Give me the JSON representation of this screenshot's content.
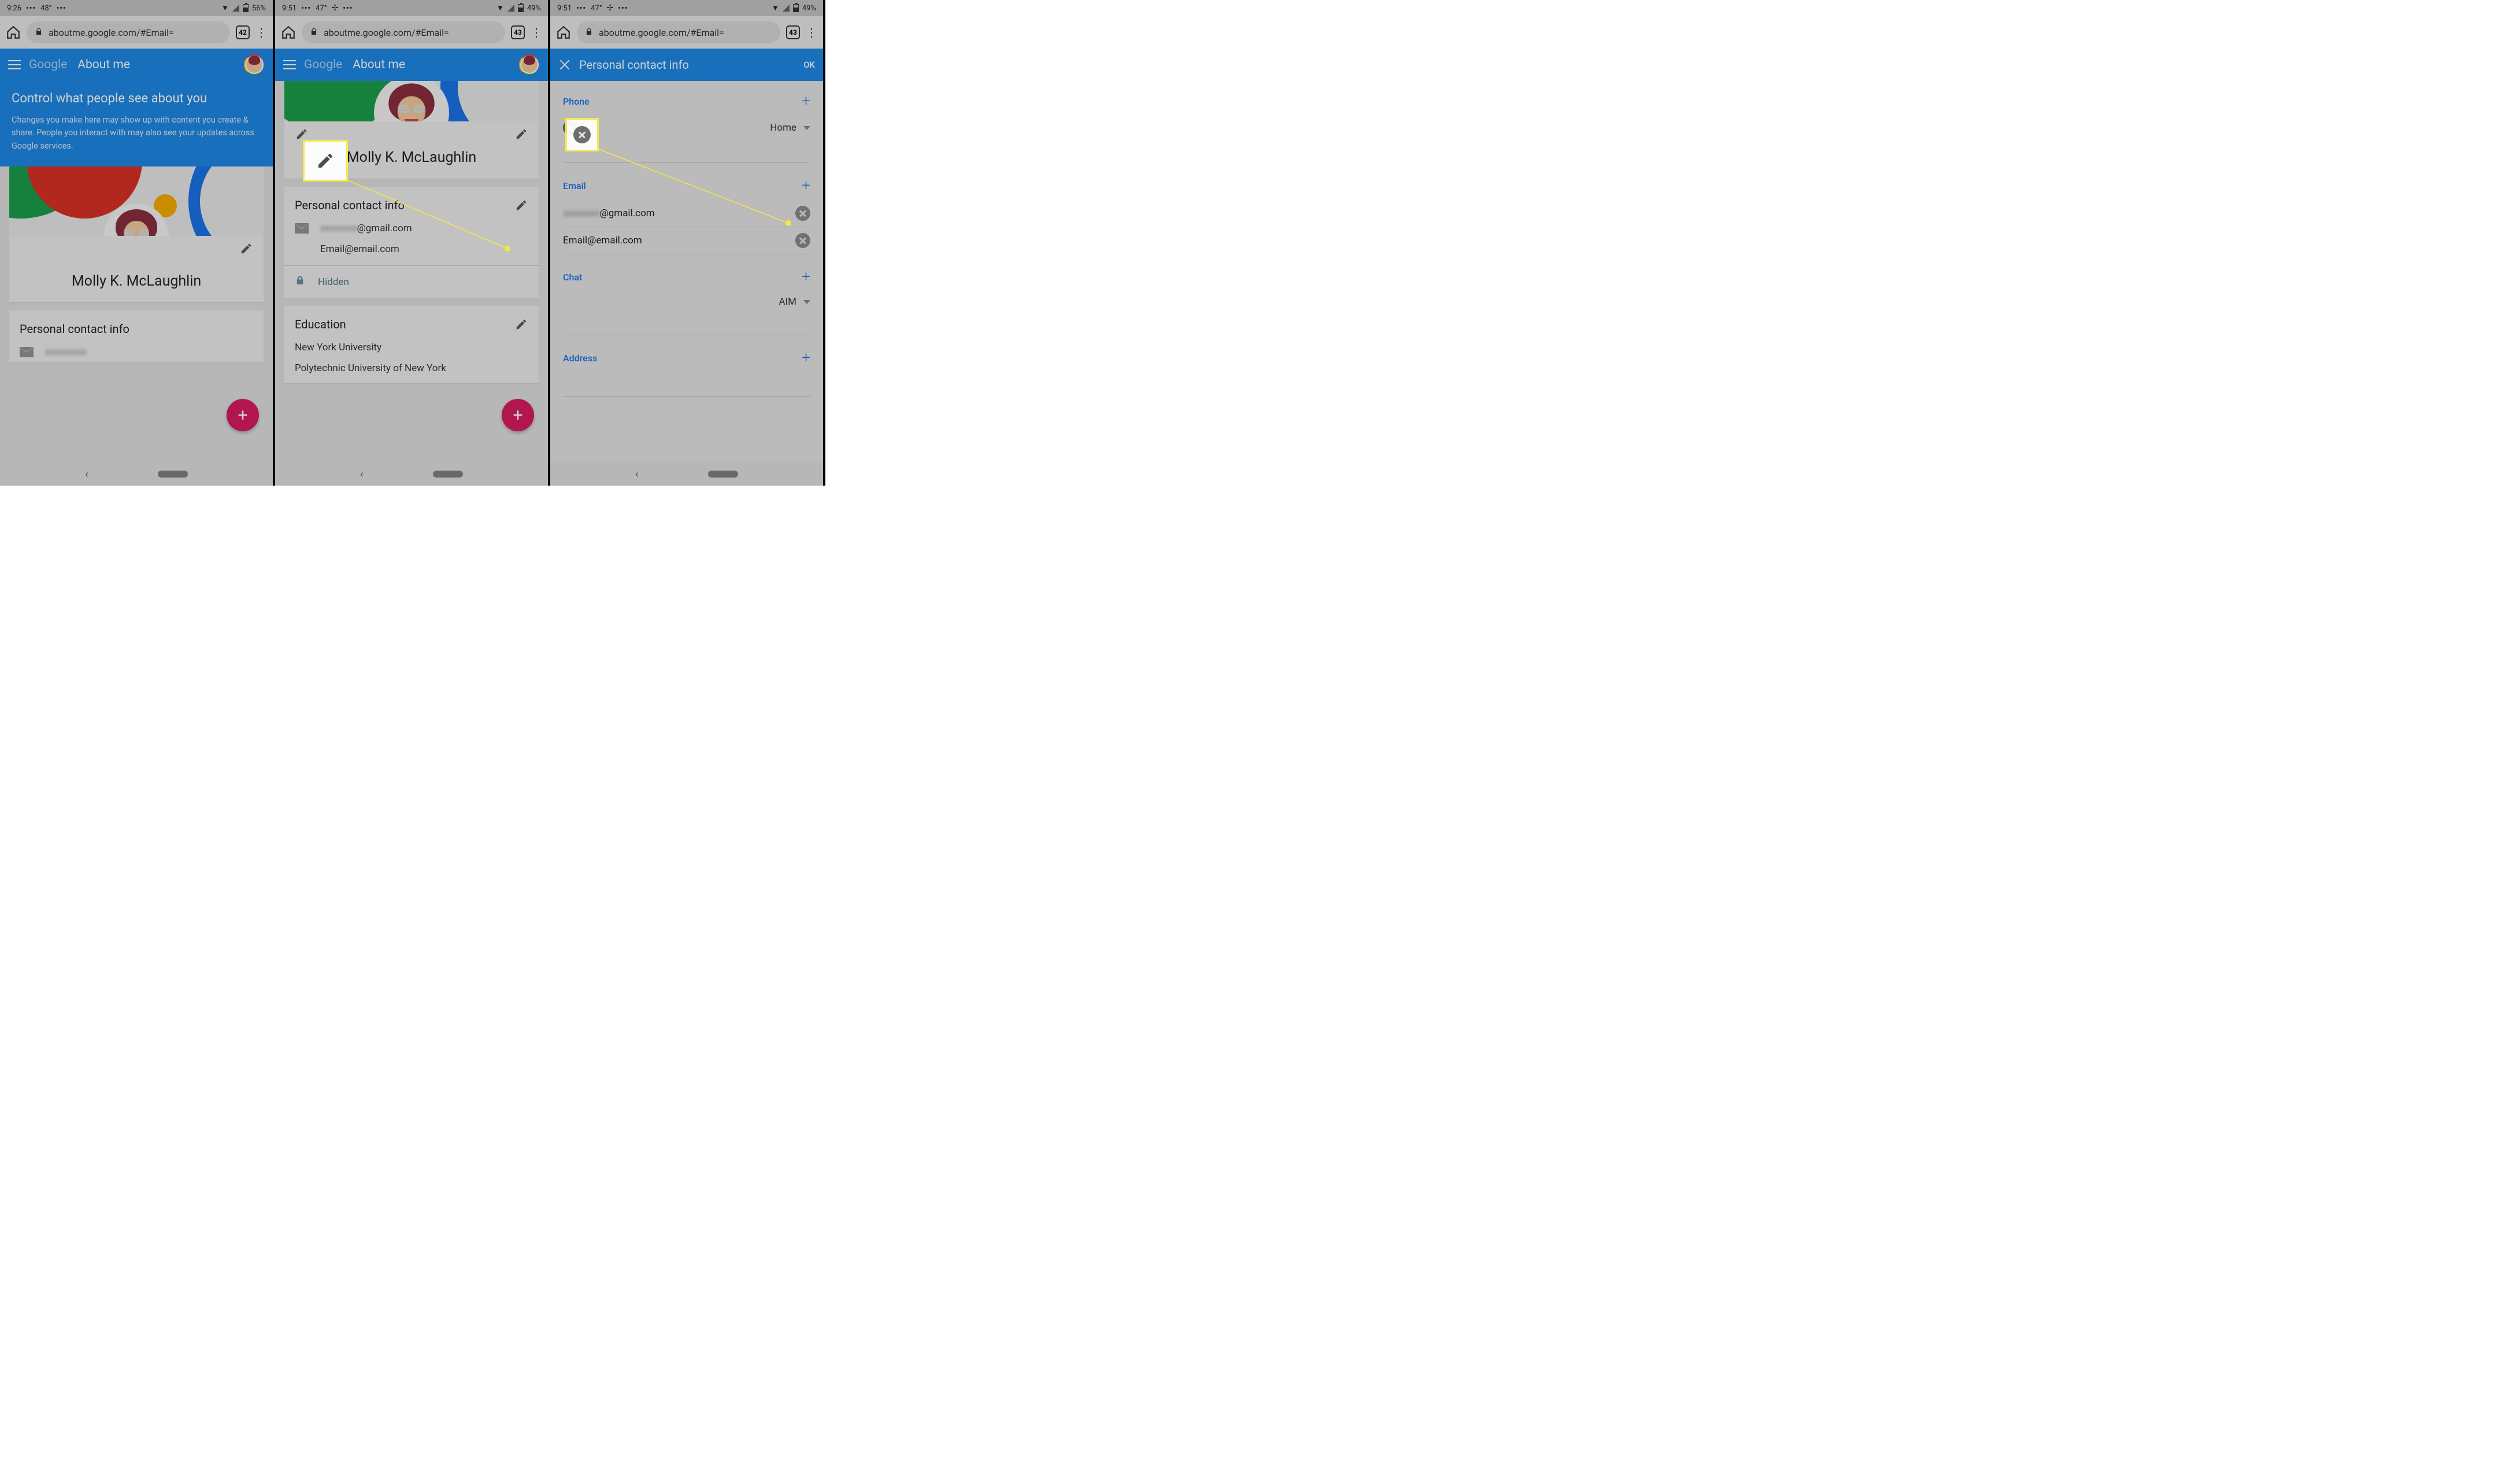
{
  "panel1": {
    "status": {
      "time": "9:26",
      "temp": "48°",
      "battery": "56%"
    },
    "browser": {
      "url": "aboutme.google.com/#Email=",
      "tabs": "42"
    },
    "header": {
      "logo": "Google",
      "title": "About me"
    },
    "hero": {
      "heading": "Control what people see about you",
      "desc": "Changes you make here may show up with content you create & share. People you interact with may also see your updates across Google services."
    },
    "name": "Molly K. McLaughlin",
    "contact_card_title": "Personal contact info"
  },
  "panel2": {
    "status": {
      "time": "9:51",
      "temp": "47°",
      "battery": "49%"
    },
    "browser": {
      "url": "aboutme.google.com/#Email=",
      "tabs": "43"
    },
    "header": {
      "logo": "Google",
      "title": "About me"
    },
    "name": "Molly K. McLaughlin",
    "contact": {
      "title": "Personal contact info",
      "email1_domain": "@gmail.com",
      "email2": "Email@email.com",
      "hidden_label": "Hidden"
    },
    "education": {
      "title": "Education",
      "items": [
        "New York University",
        "Polytechnic University of New York"
      ]
    }
  },
  "panel3": {
    "status": {
      "time": "9:51",
      "temp": "47°",
      "battery": "49%"
    },
    "browser": {
      "url": "aboutme.google.com/#Email=",
      "tabs": "43"
    },
    "header": {
      "title": "Personal contact info",
      "ok": "OK"
    },
    "phone": {
      "label": "Phone",
      "type": "Home"
    },
    "email": {
      "label": "Email",
      "domain1": "@gmail.com",
      "email2": "Email@email.com"
    },
    "chat": {
      "label": "Chat",
      "type": "AIM"
    },
    "address": {
      "label": "Address"
    }
  }
}
